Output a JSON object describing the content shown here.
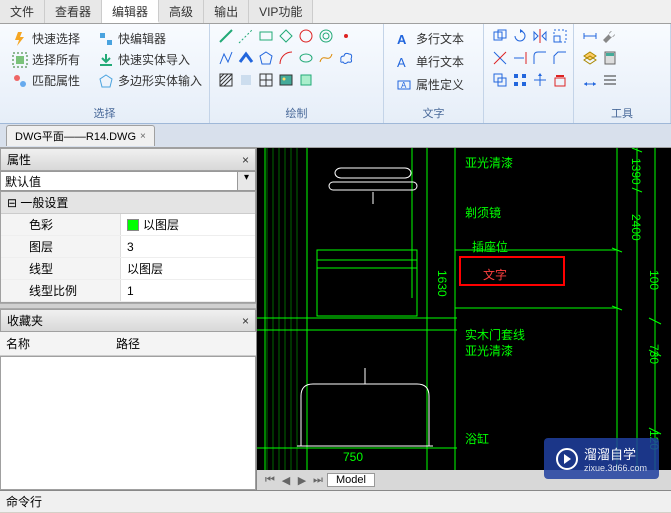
{
  "menu": {
    "items": [
      "文件",
      "查看器",
      "编辑器",
      "高级",
      "输出",
      "VIP功能"
    ],
    "active_index": 2
  },
  "ribbon": {
    "select": {
      "label": "选择",
      "quick_select": "快速选择",
      "select_all": "选择所有",
      "match_prop": "匹配属性",
      "quick_edit": "快编辑器",
      "quick_import": "快速实体导入",
      "poly_input": "多边形实体输入"
    },
    "draw": {
      "label": "绘制"
    },
    "text": {
      "label": "文字",
      "multiline": "多行文本",
      "singleline": "单行文本",
      "attrdef": "属性定义"
    },
    "tools": {
      "label": "工具"
    }
  },
  "document_tab": {
    "name": "DWG平面——R14.DWG"
  },
  "properties": {
    "title": "属性",
    "default_value": "默认值",
    "group": "一般设置",
    "rows": {
      "color": {
        "label": "色彩",
        "value": "以图层"
      },
      "layer": {
        "label": "图层",
        "value": "3"
      },
      "linetype": {
        "label": "线型",
        "value": "以图层"
      },
      "linescale": {
        "label": "线型比例",
        "value": "1"
      }
    }
  },
  "favorites": {
    "title": "收藏夹",
    "col_name": "名称",
    "col_path": "路径"
  },
  "canvas": {
    "texts": {
      "yaguang1": "亚光清漆",
      "mirror": "剃须镜",
      "socket": "插座位",
      "wenzi": "文字",
      "door": "实木门套线",
      "yaguang2": "亚光清漆",
      "bath": "浴缸"
    },
    "dims": {
      "d1390": "1390",
      "d2400": "2400",
      "d100": "100",
      "d1630": "1630",
      "d730": "730",
      "d120": "120",
      "d750": "750"
    }
  },
  "model_tab": "Model",
  "commandline": "命令行",
  "watermark": {
    "brand": "溜溜自学",
    "url": "zixue.3d66.com"
  }
}
